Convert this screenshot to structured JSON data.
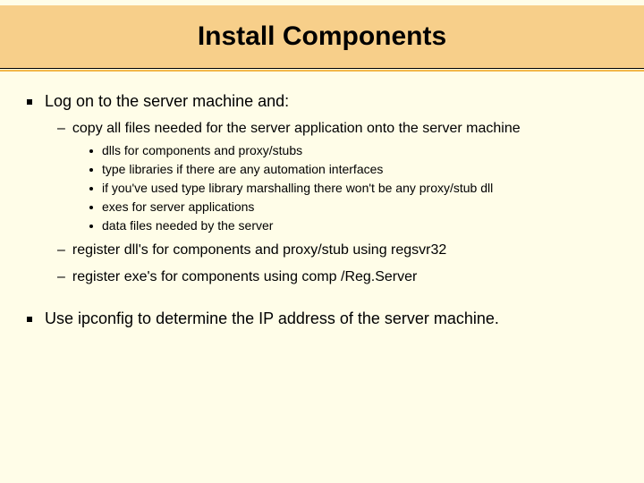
{
  "title": "Install Components",
  "bullets": [
    {
      "text": "Log on to the server machine and:",
      "sub": [
        {
          "text": "copy all files needed for the server application onto the server machine",
          "sub": [
            {
              "text": "dlls for components and proxy/stubs"
            },
            {
              "text": "type libraries if there are any automation interfaces"
            },
            {
              "text": "if you've used type library marshalling there won't be any proxy/stub dll"
            },
            {
              "text": "exes for server applications"
            },
            {
              "text": "data files needed by the server"
            }
          ]
        },
        {
          "text": "register dll's for components and proxy/stub using regsvr32"
        },
        {
          "text": "register exe's for components using comp /Reg.Server"
        }
      ]
    },
    {
      "text": "Use ipconfig to determine the IP address of the server machine."
    }
  ]
}
